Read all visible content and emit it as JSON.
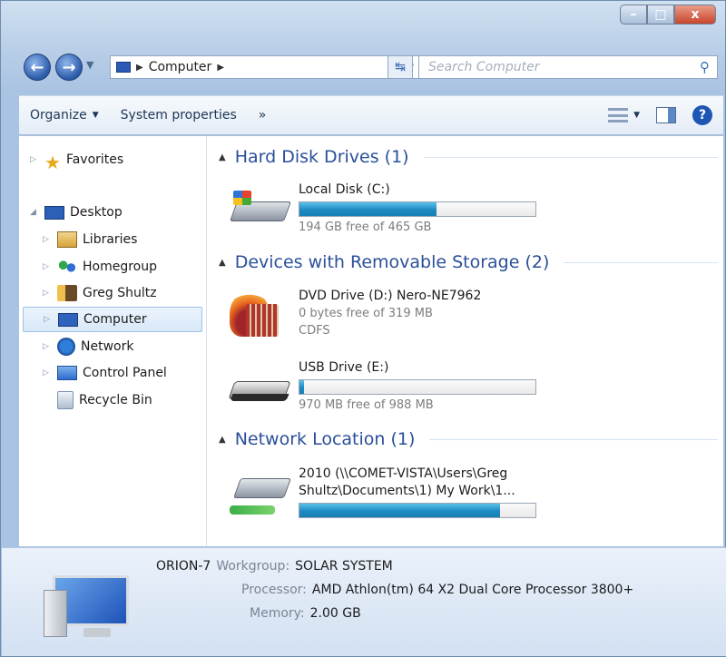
{
  "window": {
    "caption": {
      "min": "–",
      "max": "□",
      "close": "x"
    }
  },
  "address_bar": {
    "crumbs": [
      "Computer"
    ],
    "search_placeholder": "Search Computer"
  },
  "toolbar": {
    "organize": "Organize",
    "system_properties": "System properties",
    "more": "»"
  },
  "nav_pane": {
    "favorites": "Favorites",
    "desktop": "Desktop",
    "items": [
      "Libraries",
      "Homegroup",
      "Greg Shultz",
      "Computer",
      "Network",
      "Control Panel",
      "Recycle Bin"
    ],
    "selected": "Computer"
  },
  "groups": {
    "hard_disk": {
      "title": "Hard Disk Drives (1)",
      "drives": [
        {
          "name": "Local Disk (C:)",
          "free_text": "194 GB free of 465 GB",
          "used_fraction": 0.58
        }
      ]
    },
    "removable": {
      "title": "Devices with Removable Storage (2)",
      "drives": [
        {
          "name": "DVD Drive (D:) Nero-NE7962",
          "free_text": "0 bytes free of 319 MB",
          "fs": "CDFS"
        },
        {
          "name": "USB Drive (E:)",
          "free_text": "970 MB free of 988 MB",
          "used_fraction": 0.02
        }
      ]
    },
    "network": {
      "title": "Network Location (1)",
      "drives": [
        {
          "name_line1": "2010 (\\\\COMET-VISTA\\Users\\Greg",
          "name_line2": "Shultz\\Documents\\1) My Work\\1...",
          "used_fraction": 0.85
        }
      ]
    }
  },
  "details": {
    "computer_name": "ORION-7",
    "workgroup_label": "Workgroup:",
    "workgroup": "SOLAR SYSTEM",
    "processor_label": "Processor:",
    "processor": "AMD Athlon(tm) 64 X2 Dual Core Processor 3800+",
    "memory_label": "Memory:",
    "memory": "2.00 GB"
  },
  "colors": {
    "group_header": "#2a4f9a",
    "bar_fill": "#1c8bc3",
    "selection": "#d8e8f8"
  }
}
